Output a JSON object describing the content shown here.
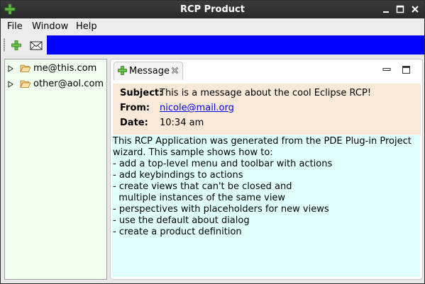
{
  "window": {
    "title": "RCP Product"
  },
  "menubar": {
    "items": [
      {
        "label": "File"
      },
      {
        "label": "Window"
      },
      {
        "label": "Help"
      }
    ]
  },
  "toolbar": {
    "buttons": [
      {
        "icon": "plus-icon",
        "tooltip": ""
      },
      {
        "icon": "envelope-icon",
        "tooltip": ""
      }
    ],
    "strip_color": "#0000ff"
  },
  "navigator": {
    "items": [
      {
        "label": "me@this.com",
        "icon": "folder-icon",
        "expanded": false
      },
      {
        "label": "other@aol.com",
        "icon": "folder-icon",
        "expanded": false
      }
    ],
    "background": "#f0fff0"
  },
  "message_view": {
    "tab_label": "Message",
    "header": {
      "subject_label": "Subject:",
      "subject_value": "This is a message about the cool Eclipse RCP!",
      "from_label": "From:",
      "from_value": "nicole@mail.org",
      "date_label": "Date:",
      "date_value": "10:34 am",
      "background": "#f8e8d8"
    },
    "body_lines": [
      "This RCP Application was generated from the PDE Plug-in Project",
      "wizard. This sample shows how to:",
      "- add a top-level menu and toolbar with actions",
      "- add keybindings to actions",
      "- create views that can't be closed and",
      "  multiple instances of the same view",
      "- perspectives with placeholders for new views",
      "- use the default about dialog",
      "- create a product definition"
    ],
    "body_background": "#e0ffff"
  }
}
